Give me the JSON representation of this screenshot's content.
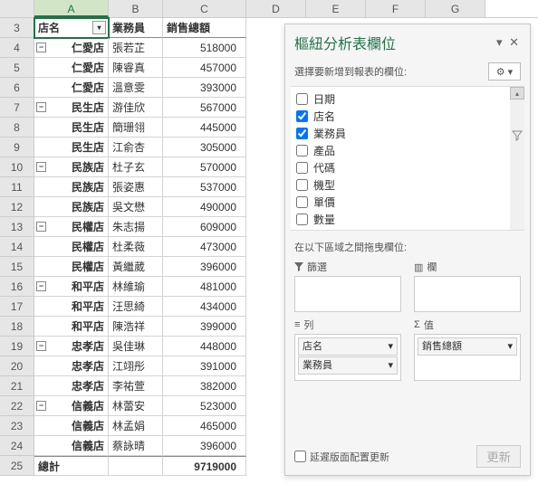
{
  "columns": [
    "A",
    "B",
    "C",
    "D",
    "E",
    "F",
    "G"
  ],
  "header_row": 3,
  "headers": {
    "a": "店名",
    "b": "業務員",
    "c": "銷售總額"
  },
  "rows": [
    {
      "n": 4,
      "exp": true,
      "a": "仁愛店",
      "b": "張若芷",
      "c": "518000"
    },
    {
      "n": 5,
      "a": "仁愛店",
      "b": "陳睿真",
      "c": "457000"
    },
    {
      "n": 6,
      "a": "仁愛店",
      "b": "溫意雯",
      "c": "393000"
    },
    {
      "n": 7,
      "exp": true,
      "a": "民生店",
      "b": "游佳欣",
      "c": "567000"
    },
    {
      "n": 8,
      "a": "民生店",
      "b": "簡珊翎",
      "c": "445000"
    },
    {
      "n": 9,
      "a": "民生店",
      "b": "江俞杏",
      "c": "305000"
    },
    {
      "n": 10,
      "exp": true,
      "a": "民族店",
      "b": "杜子玄",
      "c": "570000"
    },
    {
      "n": 11,
      "a": "民族店",
      "b": "張姿惠",
      "c": "537000"
    },
    {
      "n": 12,
      "a": "民族店",
      "b": "吳文懋",
      "c": "490000"
    },
    {
      "n": 13,
      "exp": true,
      "a": "民權店",
      "b": "朱志揚",
      "c": "609000"
    },
    {
      "n": 14,
      "a": "民權店",
      "b": "杜柔薇",
      "c": "473000"
    },
    {
      "n": 15,
      "a": "民權店",
      "b": "黃繼葳",
      "c": "396000"
    },
    {
      "n": 16,
      "exp": true,
      "a": "和平店",
      "b": "林維瑜",
      "c": "481000"
    },
    {
      "n": 17,
      "a": "和平店",
      "b": "汪思綺",
      "c": "434000"
    },
    {
      "n": 18,
      "a": "和平店",
      "b": "陳浩祥",
      "c": "399000"
    },
    {
      "n": 19,
      "exp": true,
      "a": "忠孝店",
      "b": "吳佳琳",
      "c": "448000"
    },
    {
      "n": 20,
      "a": "忠孝店",
      "b": "江翊彤",
      "c": "391000"
    },
    {
      "n": 21,
      "a": "忠孝店",
      "b": "李祐萱",
      "c": "382000"
    },
    {
      "n": 22,
      "exp": true,
      "a": "信義店",
      "b": "林蕾安",
      "c": "523000"
    },
    {
      "n": 23,
      "a": "信義店",
      "b": "林孟娟",
      "c": "465000"
    },
    {
      "n": 24,
      "a": "信義店",
      "b": "蔡詠晴",
      "c": "396000"
    }
  ],
  "total": {
    "n": 25,
    "label": "總計",
    "value": "9719000"
  },
  "pane": {
    "title": "樞紐分析表欄位",
    "subtitle": "選擇要新增到報表的欄位:",
    "fields": [
      {
        "label": "日期",
        "checked": false
      },
      {
        "label": "店名",
        "checked": true
      },
      {
        "label": "業務員",
        "checked": true
      },
      {
        "label": "產品",
        "checked": false
      },
      {
        "label": "代碼",
        "checked": false
      },
      {
        "label": "機型",
        "checked": false
      },
      {
        "label": "單價",
        "checked": false
      },
      {
        "label": "數量",
        "checked": false
      }
    ],
    "drag_label": "在以下區域之間拖曳欄位:",
    "zones": {
      "filter": "篩選",
      "columns": "欄",
      "rows": "列",
      "values": "值"
    },
    "row_items": [
      "店名",
      "業務員"
    ],
    "value_items": [
      "銷售總額"
    ],
    "defer_label": "延遲版面配置更新",
    "update_btn": "更新"
  }
}
